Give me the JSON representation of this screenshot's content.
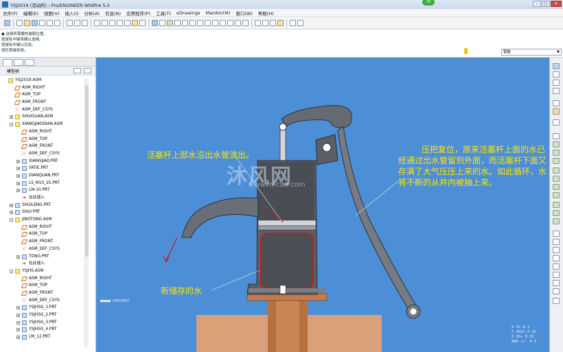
{
  "window": {
    "title": "YSJ2019 (活动的) - Pro/ENGINEER Wildfire 5.0",
    "badge": "26",
    "minimize": "–",
    "maximize": "□",
    "close": "✕"
  },
  "menu": [
    "文件(F)",
    "编辑(E)",
    "视图(V)",
    "插入(I)",
    "分析(A)",
    "信息(N)",
    "应用程序(P)",
    "工具(T)",
    "eDrawings",
    "Manikin(M)",
    "窗口(W)",
    "帮助(H)"
  ],
  "messages": [
    "● 选择所需要的装配位置。",
    "按鼠标中键来确认选择。",
    "按鼠标中键以完成。",
    "按任意键拒绝。"
  ],
  "filter": {
    "value": "智能"
  },
  "model_tree": {
    "header": "模型树",
    "items": [
      {
        "label": "YSJ2019.ASM",
        "icon": "asm",
        "indent": 0,
        "expander": ""
      },
      {
        "label": "ASM_RIGHT",
        "icon": "plane",
        "indent": 1,
        "expander": ""
      },
      {
        "label": "ASM_TOP",
        "icon": "plane",
        "indent": 1,
        "expander": ""
      },
      {
        "label": "ASM_FRONT",
        "icon": "plane",
        "indent": 1,
        "expander": ""
      },
      {
        "label": "ASM_DEF_CSYS",
        "icon": "csys",
        "indent": 1,
        "expander": ""
      },
      {
        "label": "SHUIGUAN.ASM",
        "icon": "asm",
        "indent": 1,
        "expander": "+"
      },
      {
        "label": "XIANGJIAODIAN.ASM",
        "icon": "asm",
        "indent": 1,
        "expander": "-"
      },
      {
        "label": "ASM_RIGHT",
        "icon": "plane",
        "indent": 2,
        "expander": ""
      },
      {
        "label": "ASM_TOP",
        "icon": "plane",
        "indent": 2,
        "expander": ""
      },
      {
        "label": "ASM_FRONT",
        "icon": "plane",
        "indent": 2,
        "expander": ""
      },
      {
        "label": "ASM_DEF_CSYS",
        "icon": "csys",
        "indent": 2,
        "expander": ""
      },
      {
        "label": "XIANGJIAO.PRT",
        "icon": "prt",
        "indent": 2,
        "expander": "+"
      },
      {
        "label": "YATIE.PRT",
        "icon": "prt",
        "indent": 2,
        "expander": "+"
      },
      {
        "label": "DIANQUAN.PRT",
        "icon": "prt",
        "indent": 2,
        "expander": "+"
      },
      {
        "label": "LS_M10_25.PRT",
        "icon": "prt",
        "indent": 2,
        "expander": "+"
      },
      {
        "label": "LM-10.PRT",
        "icon": "prt",
        "indent": 2,
        "expander": "+"
      },
      {
        "label": "在此插入",
        "icon": "ins",
        "indent": 2,
        "expander": ""
      },
      {
        "label": "SHUILENG.PRT",
        "icon": "prt",
        "indent": 1,
        "expander": "+"
      },
      {
        "label": "SHUI.PRT",
        "icon": "prt",
        "indent": 1,
        "expander": "+"
      },
      {
        "label": "JINGTONG.ASM",
        "icon": "asm",
        "indent": 1,
        "expander": "-"
      },
      {
        "label": "ASM_RIGHT",
        "icon": "plane",
        "indent": 2,
        "expander": ""
      },
      {
        "label": "ASM_TOP",
        "icon": "plane",
        "indent": 2,
        "expander": ""
      },
      {
        "label": "ASM_FRONT",
        "icon": "plane",
        "indent": 2,
        "expander": ""
      },
      {
        "label": "ASM_DEF_CSYS",
        "icon": "csys",
        "indent": 2,
        "expander": ""
      },
      {
        "label": "TONG.PRT",
        "icon": "prt",
        "indent": 2,
        "expander": "+"
      },
      {
        "label": "在此插入",
        "icon": "ins",
        "indent": 2,
        "expander": ""
      },
      {
        "label": "YSJHS.ASM",
        "icon": "asm",
        "indent": 1,
        "expander": "-"
      },
      {
        "label": "ASM_RIGHT",
        "icon": "plane",
        "indent": 2,
        "expander": ""
      },
      {
        "label": "ASM_TOP",
        "icon": "plane",
        "indent": 2,
        "expander": ""
      },
      {
        "label": "ASM_FRONT",
        "icon": "plane",
        "indent": 2,
        "expander": ""
      },
      {
        "label": "ASM_DEF_CSYS",
        "icon": "csys",
        "indent": 2,
        "expander": ""
      },
      {
        "label": "YSJHSG_1.PRT",
        "icon": "prt",
        "indent": 2,
        "expander": "+"
      },
      {
        "label": "YSJHSG_2.PRT",
        "icon": "prt",
        "indent": 2,
        "expander": "+"
      },
      {
        "label": "YSJHSG_3.PRT",
        "icon": "prt",
        "indent": 2,
        "expander": "+"
      },
      {
        "label": "YSJHSG_4.PRT",
        "icon": "prt",
        "indent": 2,
        "expander": "+"
      },
      {
        "label": "LM_12.PRT",
        "icon": "prt",
        "indent": 2,
        "expander": "+"
      }
    ]
  },
  "viewport": {
    "annotation_1": "活塞杆上部水沿出水管流出。",
    "annotation_2": "压把复位，原来活塞杆上面的水已经通过出水管留到外面，而活塞杆下面又存满了大气压压上来的水。如此循环，水将不断的从井内被抽上来。",
    "annotation_3": "新储存的水",
    "watermark": "沐风网",
    "watermark_url": "www.mfcad.com",
    "scale_label": "■■■■■ XSEC0002",
    "coords": [
      "X X+ 0.1",
      "Y XXX+ 0.01",
      "Z XX+ 0.01",
      "ANG +/- 0.5"
    ]
  },
  "colors": {
    "viewport_bg": "#4d8fd6",
    "annotation": "#ffe500",
    "pump_body": "#5a5e66",
    "well_pipe": "#b8703f"
  }
}
